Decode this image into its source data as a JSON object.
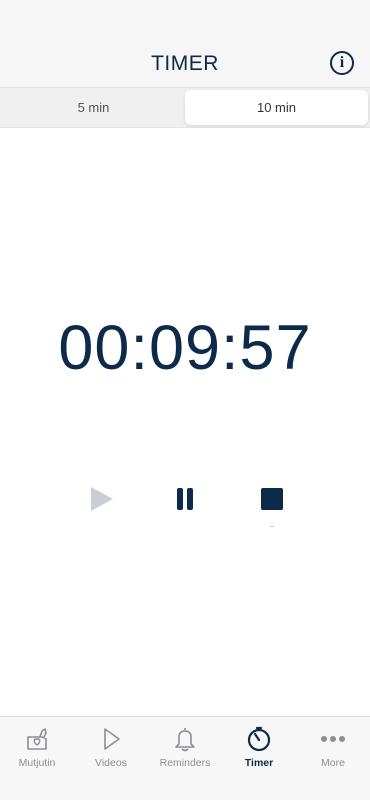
{
  "header": {
    "title": "TIMER",
    "info_icon": "info-icon",
    "info_glyph": "i"
  },
  "segments": [
    {
      "label": "5 min",
      "selected": false
    },
    {
      "label": "10 min",
      "selected": true
    }
  ],
  "timer": {
    "display": "00:09:57"
  },
  "controls": {
    "play_icon": "play-icon",
    "pause_icon": "pause-icon",
    "stop_icon": "stop-icon"
  },
  "tabs": [
    {
      "label": "Mutjutin",
      "icon": "heart-box-icon",
      "active": false
    },
    {
      "label": "Videos",
      "icon": "play-outline-icon",
      "active": false
    },
    {
      "label": "Reminders",
      "icon": "bell-icon",
      "active": false
    },
    {
      "label": "Timer",
      "icon": "timer-icon",
      "active": true
    },
    {
      "label": "More",
      "icon": "more-dots-icon",
      "active": false
    }
  ],
  "colors": {
    "accent": "#0d2a4a",
    "inactive": "#8e8e93",
    "disabled": "#c9ced5"
  }
}
